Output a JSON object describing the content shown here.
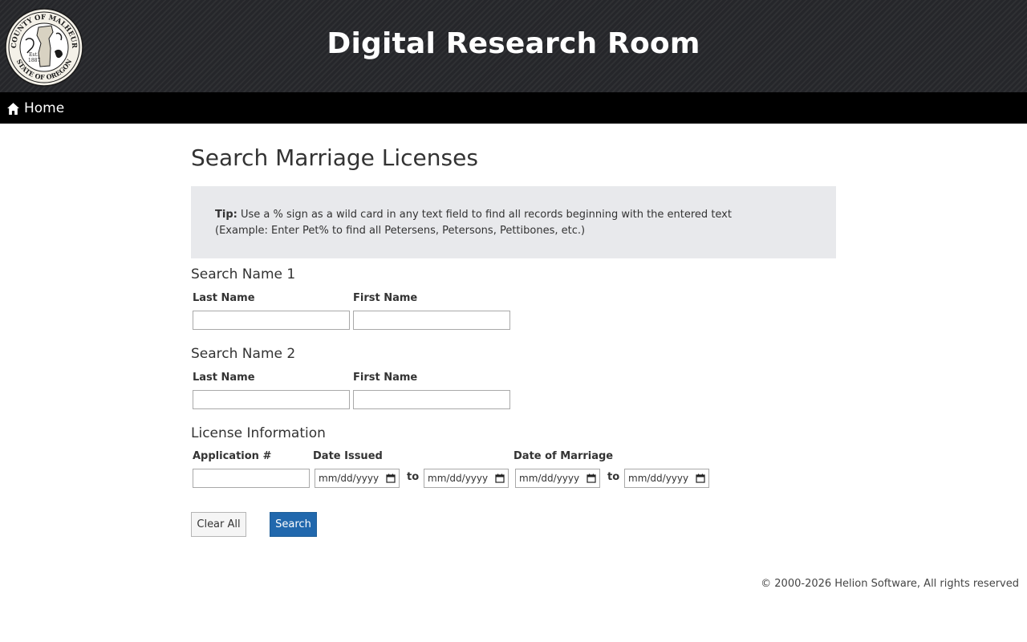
{
  "header": {
    "title": "Digital Research Room",
    "seal": {
      "top_text": "COUNTY OF MALHEUR",
      "bottom_text": "STATE OF OREGON",
      "est_text": "Est. 1887",
      "icon": "county-seal-icon"
    }
  },
  "nav": {
    "home_label": "Home",
    "home_icon": "home-icon"
  },
  "page": {
    "title": "Search Marriage Licenses",
    "tip_label": "Tip:",
    "tip_line1": " Use a % sign as a wild card in any text field to find all records beginning with the entered text",
    "tip_line2": "(Example: Enter Pet% to find all Petersens, Petersons, Pettibones, etc.)"
  },
  "name1": {
    "title": "Search Name 1",
    "last_label": "Last Name",
    "first_label": "First Name",
    "last_value": "",
    "first_value": ""
  },
  "name2": {
    "title": "Search Name 2",
    "last_label": "Last Name",
    "first_label": "First Name",
    "last_value": "",
    "first_value": ""
  },
  "license": {
    "title": "License Information",
    "application_label": "Application #",
    "application_value": "",
    "date_issued_label": "Date Issued",
    "date_marriage_label": "Date of Marriage",
    "to_label": "to",
    "date_placeholder": "mm/dd/yyyy"
  },
  "buttons": {
    "clear_label": "Clear All",
    "search_label": "Search"
  },
  "footer": {
    "copyright": "© 2000-2026 Helion Software, All rights reserved"
  },
  "colors": {
    "banner_bg": "#2b2c2e",
    "nav_bg": "#000000",
    "tip_bg": "#e8e9ec",
    "search_button": "#2168ad"
  }
}
